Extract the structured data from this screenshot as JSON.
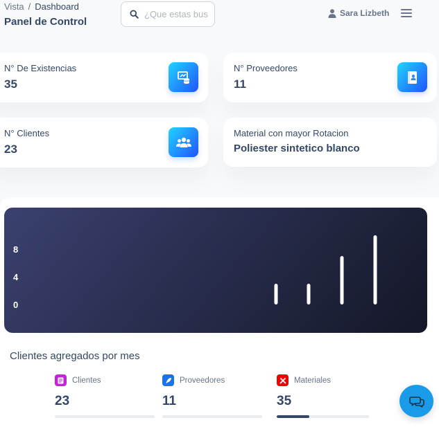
{
  "breadcrumb": {
    "root": "Vista",
    "separator": "/",
    "current": "Dashboard"
  },
  "page_title": "Panel de Control",
  "search": {
    "placeholder": "¿Que estas bus",
    "value": ""
  },
  "user": {
    "name": "Sara Lizbeth",
    "icon": "user-icon"
  },
  "menu_icon": "hamburger-icon",
  "stats": [
    {
      "label": "N° De Existencias",
      "value": "35",
      "icon": "inventory-icon"
    },
    {
      "label": "N° Proveedores",
      "value": "11",
      "icon": "supplier-book-icon"
    },
    {
      "label": "N° Clientes",
      "value": "23",
      "icon": "users-group-icon"
    },
    {
      "label": "Material con mayor Rotacion",
      "value": "Poliester sintetico blanco"
    }
  ],
  "chart_data": {
    "type": "bar",
    "title": "",
    "xlabel": "",
    "ylabel": "",
    "ylim": [
      0,
      10
    ],
    "yticks": [
      "8",
      "4",
      "0"
    ],
    "values": [
      3,
      3,
      7,
      10
    ],
    "grid": false
  },
  "section_title": "Clientes agregados por mes",
  "mini_stats": [
    {
      "label": "Clientes",
      "value": "23",
      "icon": "clients-icon",
      "icon_color": "#c026d3",
      "progress": 0
    },
    {
      "label": "Proveedores",
      "value": "11",
      "icon": "rocket-icon",
      "icon_color": "#1a73e8",
      "progress": 0
    },
    {
      "label": "Materiales",
      "value": "35",
      "icon": "tools-icon",
      "icon_color": "#ea0606",
      "progress": 0.35
    }
  ],
  "chat_icon": "chat-icon",
  "colors": {
    "accent": "#2152ff",
    "text": "#344767",
    "muted": "#67748e",
    "fab": "#1a9bea"
  }
}
